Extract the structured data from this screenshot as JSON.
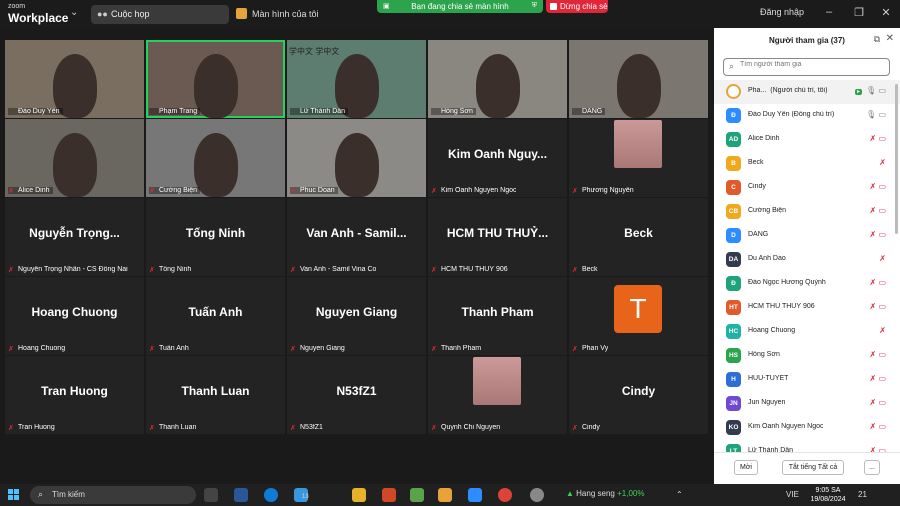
{
  "app": {
    "logo_top": "zoom",
    "logo_bottom": "Workplace",
    "tab_meeting": "Cuộc họp",
    "tab_screen": "Màn hình của tôi",
    "share_status": "Bạn đang chia sẻ màn hình",
    "stop_share": "Dừng chia sẻ",
    "sign_in": "Đăng nhập"
  },
  "gallery": {
    "tiles": [
      {
        "big": "",
        "label": "Đào Duy Yên",
        "video": true,
        "muted": false
      },
      {
        "big": "",
        "label": "Phạm Trang",
        "video": true,
        "muted": false,
        "active": true
      },
      {
        "big": "",
        "label": "Lữ Thành Dân",
        "video": true,
        "muted": false
      },
      {
        "big": "",
        "label": "Hồng Sơn",
        "video": true,
        "muted": false
      },
      {
        "big": "",
        "label": "DANG",
        "video": true,
        "muted": false
      },
      {
        "big": "",
        "label": "Alice Dinh",
        "video": true,
        "muted": true
      },
      {
        "big": "",
        "label": "Cường Biện",
        "video": true,
        "muted": true
      },
      {
        "big": "",
        "label": "Phuc Doan",
        "video": true,
        "muted": true
      },
      {
        "big": "Kim Oanh Nguy...",
        "label": "Kim Oanh Nguyen Ngoc",
        "video": false,
        "muted": true
      },
      {
        "big": "",
        "label": "Phương Nguyễn",
        "video": false,
        "muted": true,
        "thumb": true
      },
      {
        "big": "Nguyễn Trọng...",
        "label": "Nguyễn Trọng Nhân - CS Đồng Nai",
        "video": false,
        "muted": true
      },
      {
        "big": "Tống Ninh",
        "label": "Tống Ninh",
        "video": false,
        "muted": true
      },
      {
        "big": "Van Anh - Samil...",
        "label": "Van Anh - Samil Vina Co",
        "video": false,
        "muted": true
      },
      {
        "big": "HCM THU THUỶ...",
        "label": "HCM THU THUỶ 906",
        "video": false,
        "muted": true
      },
      {
        "big": "Beck",
        "label": "Beck",
        "video": false,
        "muted": true
      },
      {
        "big": "Hoang Chuong",
        "label": "Hoang Chuong",
        "video": false,
        "muted": true
      },
      {
        "big": "Tuấn Anh",
        "label": "Tuấn Anh",
        "video": false,
        "muted": true
      },
      {
        "big": "Nguyen Giang",
        "label": "Nguyen Giang",
        "video": false,
        "muted": true
      },
      {
        "big": "Thanh Pham",
        "label": "Thanh Pham",
        "video": false,
        "muted": true
      },
      {
        "big": "",
        "label": "Phan Vy",
        "video": false,
        "muted": true,
        "avatar": "T"
      },
      {
        "big": "Tran Huong",
        "label": "Tran Huong",
        "video": false,
        "muted": true
      },
      {
        "big": "Thanh Luan",
        "label": "Thanh Luan",
        "video": false,
        "muted": true
      },
      {
        "big": "N53fZ1",
        "label": "N53fZ1",
        "video": false,
        "muted": true
      },
      {
        "big": "",
        "label": "Quynh Chi Nguyen",
        "video": false,
        "muted": true,
        "thumb": true
      },
      {
        "big": "Cindy",
        "label": "Cindy",
        "video": false,
        "muted": true
      }
    ],
    "overlay_text": "学中文 学中文"
  },
  "panel": {
    "title": "Người tham gia (37)",
    "search_placeholder": "Tìm người tham gia",
    "participants": [
      {
        "initials": "",
        "name": "Pha...",
        "role": "(Người chủ trì, tôi)",
        "color": "#e8a33a"
      },
      {
        "initials": "Đ",
        "name": "Đào Duy Yên (Đồng chủ trì)",
        "role": "",
        "color": "#2d8cff"
      },
      {
        "initials": "AD",
        "name": "Alice Dinh",
        "role": "",
        "color": "#1fa37a"
      },
      {
        "initials": "B",
        "name": "Beck",
        "role": "",
        "color": "#f0a81c"
      },
      {
        "initials": "C",
        "name": "Cindy",
        "role": "",
        "color": "#e05a2b"
      },
      {
        "initials": "CB",
        "name": "Cường Biện",
        "role": "",
        "color": "#f0a81c"
      },
      {
        "initials": "D",
        "name": "DANG",
        "role": "",
        "color": "#2d8cff"
      },
      {
        "initials": "DA",
        "name": "Du Anh Dao",
        "role": "",
        "color": "#333c4e"
      },
      {
        "initials": "Đ",
        "name": "Đào Ngọc Hương Quỳnh",
        "role": "",
        "color": "#1fa37a"
      },
      {
        "initials": "HT",
        "name": "HCM THU THUỶ 906",
        "role": "",
        "color": "#e05a2b"
      },
      {
        "initials": "HC",
        "name": "Hoang Chuong",
        "role": "",
        "color": "#1fb3a3"
      },
      {
        "initials": "HS",
        "name": "Hồng Sơn",
        "role": "",
        "color": "#2ca44d"
      },
      {
        "initials": "H",
        "name": "HUU-TUYET",
        "role": "",
        "color": "#2d6fd6"
      },
      {
        "initials": "JN",
        "name": "Jun Nguyen",
        "role": "",
        "color": "#6d4ad1"
      },
      {
        "initials": "KO",
        "name": "Kim Oanh Nguyen Ngoc",
        "role": "",
        "color": "#333c4e"
      },
      {
        "initials": "LT",
        "name": "Lữ Thành Dân",
        "role": "",
        "color": "#1fa37a"
      }
    ],
    "invite": "Mời",
    "mute_all": "Tắt tiếng Tất cả",
    "more": "..."
  },
  "taskbar": {
    "search": "Tìm kiếm",
    "stock_name": "Hang seng",
    "stock_change": "+1,00%",
    "lang": "VIE",
    "time": "9:05 SA",
    "date": "19/08/2024",
    "notif": "21",
    "badge": "13"
  }
}
